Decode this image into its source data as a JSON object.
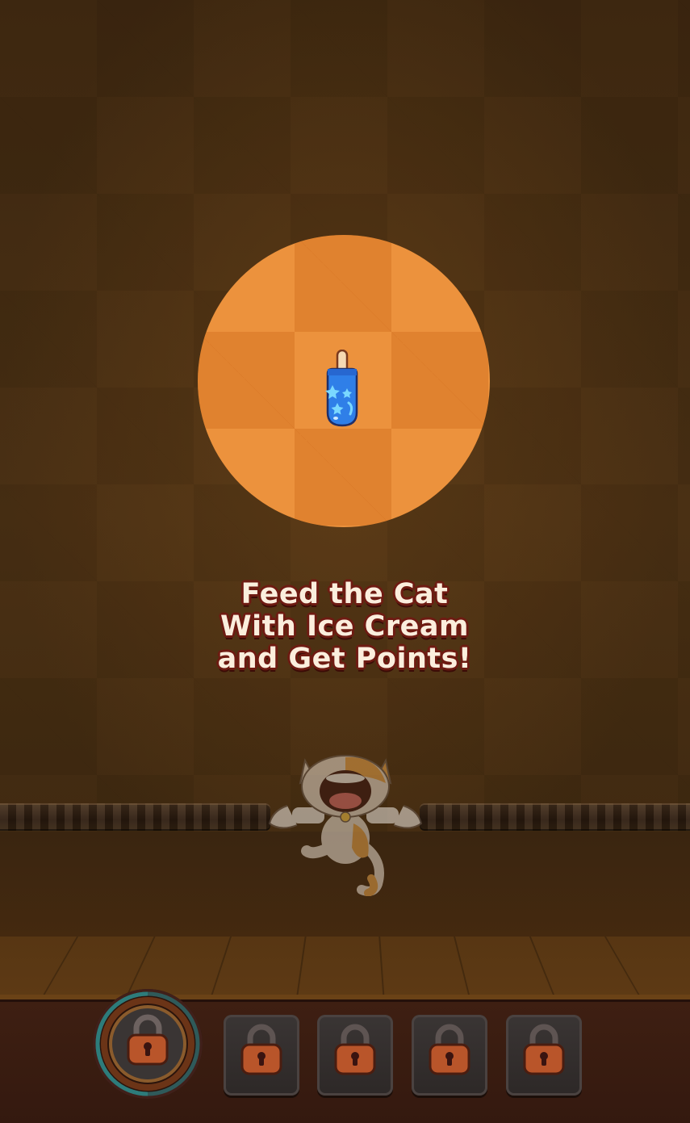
{
  "instruction": {
    "line1": "Feed the Cat",
    "line2": "With Ice Cream",
    "line3": "and Get Points!"
  },
  "popsicle": {
    "flavor": "blue-star",
    "color": "#2f7fe8"
  },
  "cat": {
    "state": "mouth-open"
  },
  "toolbar": {
    "powerup": {
      "icon": "lock-icon",
      "locked": true
    },
    "slots": [
      {
        "icon": "lock-icon",
        "locked": true
      },
      {
        "icon": "lock-icon",
        "locked": true
      },
      {
        "icon": "lock-icon",
        "locked": true
      },
      {
        "icon": "lock-icon",
        "locked": true
      }
    ]
  },
  "colors": {
    "background": "#3d2710",
    "spotlight": "#ec923d",
    "text_fill": "#fbeedd",
    "text_outline": "#6e1b12",
    "lock": "#b9552a"
  }
}
